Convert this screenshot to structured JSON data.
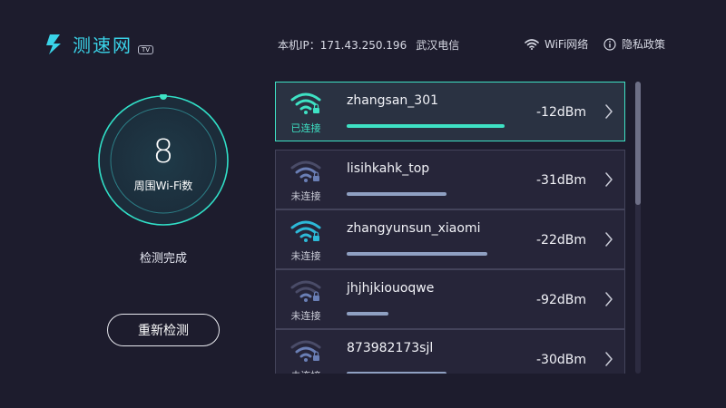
{
  "app": {
    "name": "测速网",
    "badge": "TV"
  },
  "header": {
    "ip_label": "本机IP：171.43.250.196",
    "isp": "武汉电信",
    "nav": {
      "wifi_label": "WiFi网络",
      "privacy_label": "隐私政策"
    }
  },
  "summary": {
    "count": "8",
    "count_label": "周围Wi-Fi数",
    "status": "检测完成",
    "rescan_label": "重新检测"
  },
  "colors": {
    "accent": "#3ee2c4",
    "brand": "#3ad3e8",
    "background": "#1d1c2d"
  },
  "networks": [
    {
      "ssid": "zhangsan_301",
      "state": "已连接",
      "dbm": "-12dBm",
      "strength": 0.98,
      "connected": true
    },
    {
      "ssid": "lisihkahk_top",
      "state": "未连接",
      "dbm": "-31dBm",
      "strength": 0.62,
      "connected": false
    },
    {
      "ssid": "zhangyunsun_xiaomi",
      "state": "未连接",
      "dbm": "-22dBm",
      "strength": 0.87,
      "connected": false
    },
    {
      "ssid": "jhjhjkiouoqwe",
      "state": "未连接",
      "dbm": "-92dBm",
      "strength": 0.26,
      "connected": false
    },
    {
      "ssid": "873982173sjl",
      "state": "未连接",
      "dbm": "-30dBm",
      "strength": 0.62,
      "connected": false
    }
  ]
}
